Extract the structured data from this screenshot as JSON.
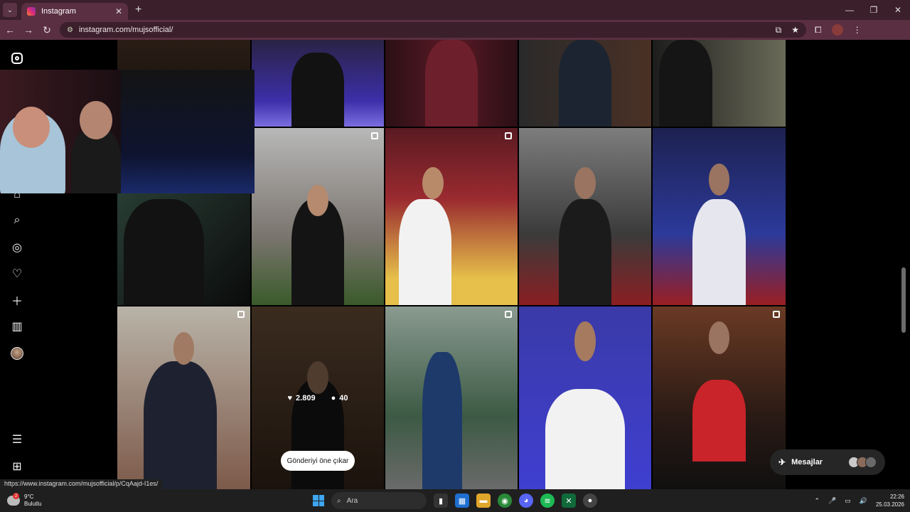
{
  "browser": {
    "tab_title": "Instagram",
    "url": "instagram.com/mujsofficial/",
    "status_url": "https://www.instagram.com/mujsofficial/p/CqAajd-I1es/"
  },
  "post_overlay": {
    "likes": "2.809",
    "comments": "40",
    "highlight_label": "Gönderiyi öne çıkar"
  },
  "messages": {
    "label": "Mesajlar"
  },
  "taskbar": {
    "weather_temp": "9°C",
    "weather_desc": "Bulutlu",
    "weather_badge": "2",
    "search_placeholder": "Ara",
    "time": "22:26",
    "date": "25.03.2026"
  },
  "colors": {
    "accent_tab": "#5a2f41",
    "chrome_dark": "#3b1f2b",
    "page_bg": "#000000"
  }
}
